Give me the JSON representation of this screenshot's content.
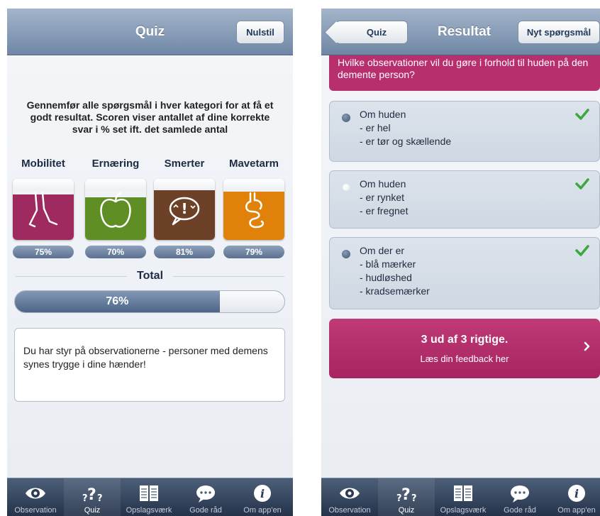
{
  "colors": {
    "navbar": "#8599b6",
    "magenta": "#b82f6d",
    "mobilitet": "#9e2a60",
    "ernaering": "#5f8e24",
    "smerter": "#6d4128",
    "mavetarm": "#e0820a",
    "check": "#3aa83a"
  },
  "left": {
    "nav": {
      "title": "Quiz",
      "reset_label": "Nulstil"
    },
    "intro": "Gennemfør alle spørgsmål i hver kategori for at få et godt resultat. Scoren viser antallet af dine korrekte svar i % set ift. det samlede antal",
    "categories": [
      {
        "label": "Mobilitet",
        "pct": "75%",
        "value": 75,
        "icon": "legs-icon"
      },
      {
        "label": "Ernæring",
        "pct": "70%",
        "value": 70,
        "icon": "apple-icon"
      },
      {
        "label": "Smerter",
        "pct": "81%",
        "value": 81,
        "icon": "pain-speech-icon"
      },
      {
        "label": "Mavetarm",
        "pct": "79%",
        "value": 79,
        "icon": "stomach-icon"
      }
    ],
    "total": {
      "label": "Total",
      "pct": "76%",
      "value": 76
    },
    "feedback": "Du har styr på observationerne - personer med demens synes trygge i dine hænder!"
  },
  "right": {
    "nav": {
      "title": "Resultat",
      "back_label": "Quiz",
      "new_question_label": "Nyt spørgsmål"
    },
    "question": "Hvilke observationer vil du gøre i forhold til huden på den demente person?",
    "options": [
      {
        "lines": [
          "Om huden",
          "- er hel",
          "- er tør og skællende"
        ],
        "selected": true,
        "correct": true
      },
      {
        "lines": [
          "Om huden",
          "- er rynket",
          "- er fregnet"
        ],
        "selected": false,
        "correct": true
      },
      {
        "lines": [
          "Om der er",
          "- blå mærker",
          "- hudløshed",
          "- kradsemærker"
        ],
        "selected": true,
        "correct": true
      }
    ],
    "result": {
      "main": "3 ud af 3 rigtige.",
      "sub": "Læs din feedback her"
    }
  },
  "tabbar": {
    "tabs": [
      {
        "label": "Observation",
        "icon": "eye-icon"
      },
      {
        "label": "Quiz",
        "icon": "question-marks-icon",
        "active": true
      },
      {
        "label": "Opslagsværk",
        "icon": "book-icon"
      },
      {
        "label": "Gode råd",
        "icon": "speech-bubble-icon"
      },
      {
        "label": "Om app'en",
        "icon": "info-icon"
      }
    ]
  }
}
